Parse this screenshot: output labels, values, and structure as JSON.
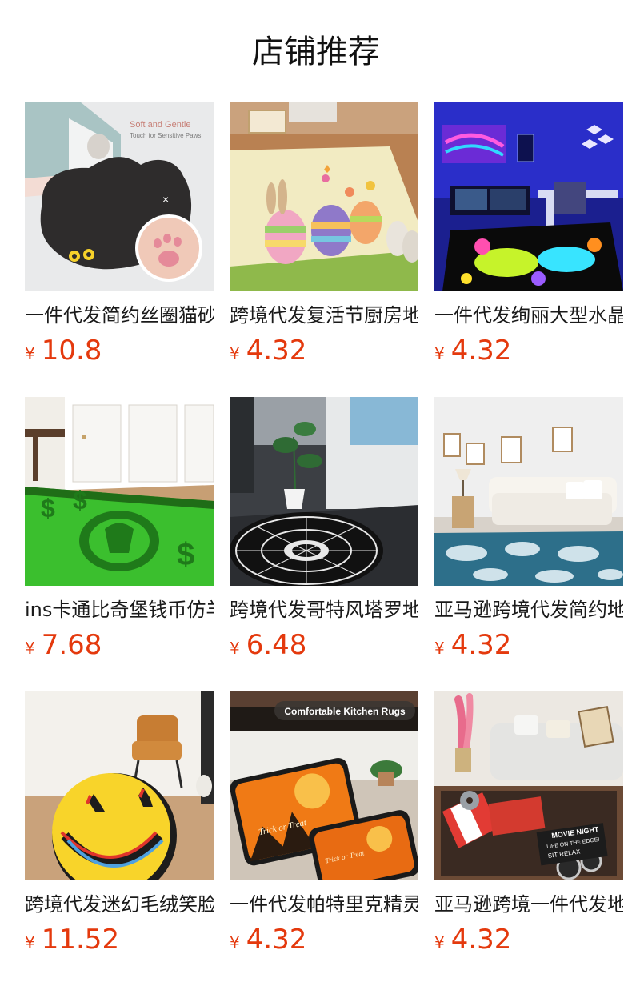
{
  "section_title": "店铺推荐",
  "products": [
    {
      "name": "一件代发简约丝圈猫砂垫",
      "currency": "¥",
      "price": "10.8",
      "image_caption": "Soft and Gentle",
      "image_subcaption": "Touch for Sensitive Paws"
    },
    {
      "name": "跨境代发复活节厨房地垫",
      "currency": "¥",
      "price": "4.32"
    },
    {
      "name": "一件代发绚丽大型水晶地毯",
      "currency": "¥",
      "price": "4.32"
    },
    {
      "name": "ins卡通比奇堡钱币仿羊绒地毯",
      "currency": "¥",
      "price": "7.68"
    },
    {
      "name": "跨境代发哥特风塔罗地垫",
      "currency": "¥",
      "price": "6.48"
    },
    {
      "name": "亚马逊跨境代发简约地毯",
      "currency": "¥",
      "price": "4.32"
    },
    {
      "name": "跨境代发迷幻毛绒笑脸地毯",
      "currency": "¥",
      "price": "11.52"
    },
    {
      "name": "一件代发帕特里克精灵地垫",
      "currency": "¥",
      "price": "4.32",
      "image_caption": "Comfortable Kitchen Rugs",
      "image_labels": [
        "Trick or Treat",
        "Trick or Treat"
      ]
    },
    {
      "name": "亚马逊跨境一件代发地毯",
      "currency": "¥",
      "price": "4.32",
      "image_labels": [
        "MOVIE NIGHT",
        "LIFE ON THE EDGE!",
        "SIT RELAX"
      ]
    }
  ]
}
